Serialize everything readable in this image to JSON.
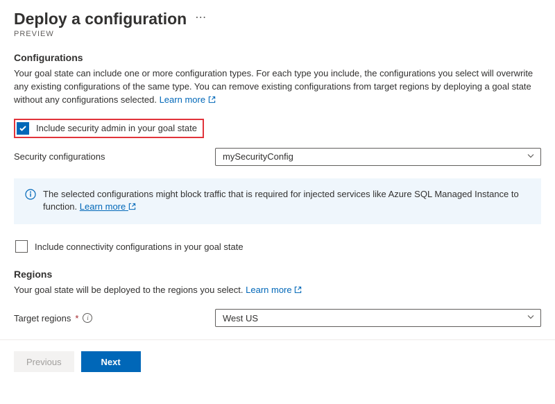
{
  "header": {
    "title": "Deploy a configuration",
    "preview": "PREVIEW"
  },
  "configurations": {
    "heading": "Configurations",
    "desc": "Your goal state can include one or more configuration types. For each type you include, the configurations you select will overwrite any existing configurations of the same type. You can remove existing configurations from target regions by deploying a goal state without any configurations selected. ",
    "learn_more": "Learn more",
    "include_security_label": "Include security admin in your goal state",
    "security_config_label": "Security configurations",
    "security_config_value": "mySecurityConfig",
    "banner_text": "The selected configurations might block traffic that is required for injected services like Azure SQL Managed Instance to function.  ",
    "banner_learn_more": "Learn more",
    "include_connectivity_label": "Include connectivity configurations in your goal state"
  },
  "regions": {
    "heading": "Regions",
    "desc": "Your goal state will be deployed to the regions you select. ",
    "learn_more": "Learn more",
    "target_regions_label": "Target regions",
    "target_regions_value": "West US"
  },
  "footer": {
    "previous": "Previous",
    "next": "Next"
  }
}
